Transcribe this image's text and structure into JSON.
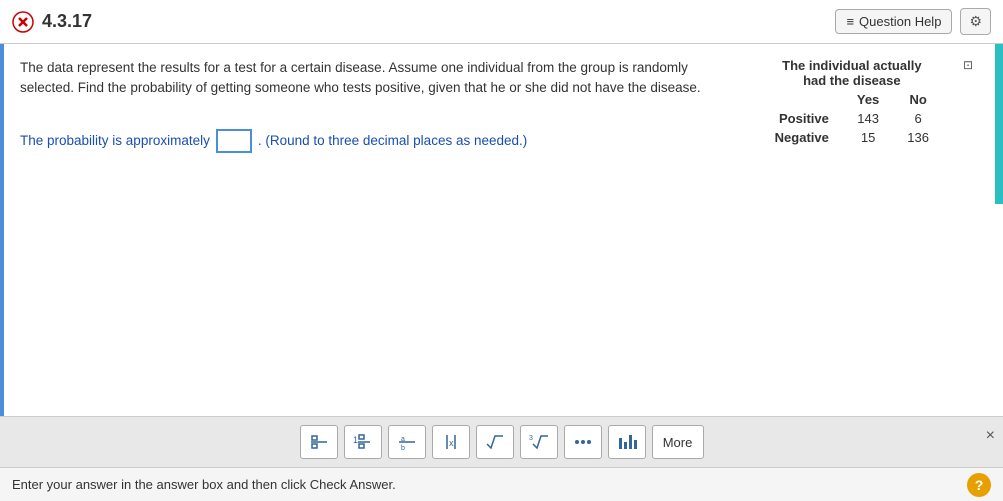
{
  "header": {
    "problem_id": "4.3.17",
    "question_help_label": "Question Help",
    "gear_icon": "⚙"
  },
  "question": {
    "text": "The data represent the results for a test for a certain disease. Assume one individual from the group is randomly selected. Find the probability of getting someone who tests positive, given that he or she did not have the disease.",
    "table": {
      "title": "The individual actually",
      "subtitle": "had the disease",
      "col_yes": "Yes",
      "col_no": "No",
      "rows": [
        {
          "label": "Positive",
          "yes": "143",
          "no": "6"
        },
        {
          "label": "Negative",
          "yes": "15",
          "no": "136"
        }
      ]
    }
  },
  "answer": {
    "prefix": "The probability is approximately",
    "suffix": ". (Round to three decimal places as needed.)",
    "input_placeholder": ""
  },
  "toolbar": {
    "buttons": [
      {
        "symbol": "⊞",
        "name": "fraction-icon"
      },
      {
        "symbol": "⊟",
        "name": "mixed-fraction-icon"
      },
      {
        "symbol": "⊡",
        "name": "small-fraction-icon"
      },
      {
        "symbol": "|||",
        "name": "absolute-value-icon"
      },
      {
        "symbol": "√",
        "name": "sqrt-icon"
      },
      {
        "symbol": "∛",
        "name": "cbrt-icon"
      },
      {
        "symbol": "⊠",
        "name": "dots-icon"
      },
      {
        "symbol": "…",
        "name": "bar-icon"
      },
      {
        "label": "More",
        "name": "more-button"
      }
    ],
    "close_label": "×"
  },
  "status_bar": {
    "text": "Enter your answer in the answer box and then click Check Answer.",
    "help_label": "?"
  }
}
